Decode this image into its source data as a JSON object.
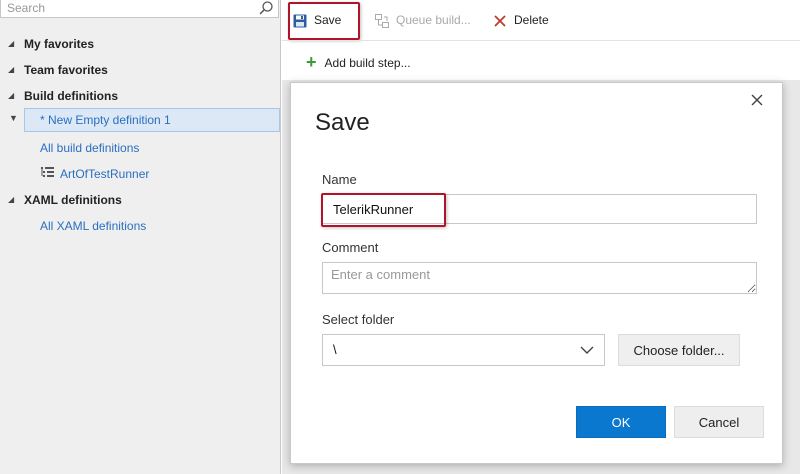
{
  "sidebar": {
    "search": {
      "placeholder": "Search",
      "value": ""
    },
    "sections": [
      {
        "label": "My favorites"
      },
      {
        "label": "Team favorites"
      },
      {
        "label": "Build definitions"
      },
      {
        "label": "XAML definitions"
      }
    ],
    "selected_item": "* New Empty definition 1",
    "build_links": [
      "All build definitions",
      "ArtOfTestRunner"
    ],
    "xaml_links": [
      "All XAML definitions"
    ]
  },
  "toolbar": {
    "save_label": "Save",
    "queue_label": "Queue build...",
    "delete_label": "Delete"
  },
  "main": {
    "add_step_label": "Add build step..."
  },
  "dialog": {
    "title": "Save",
    "name_label": "Name",
    "name_value": "TelerikRunner",
    "comment_label": "Comment",
    "comment_placeholder": "Enter a comment",
    "folder_label": "Select folder",
    "folder_value": "\\",
    "choose_folder_label": "Choose folder...",
    "ok_label": "OK",
    "cancel_label": "Cancel"
  },
  "colors": {
    "accent": "#0b78d0",
    "link": "#2a6fc1",
    "highlight_border": "#b0142b",
    "add_icon": "#3a9a3a",
    "delete_icon": "#c0392b"
  }
}
